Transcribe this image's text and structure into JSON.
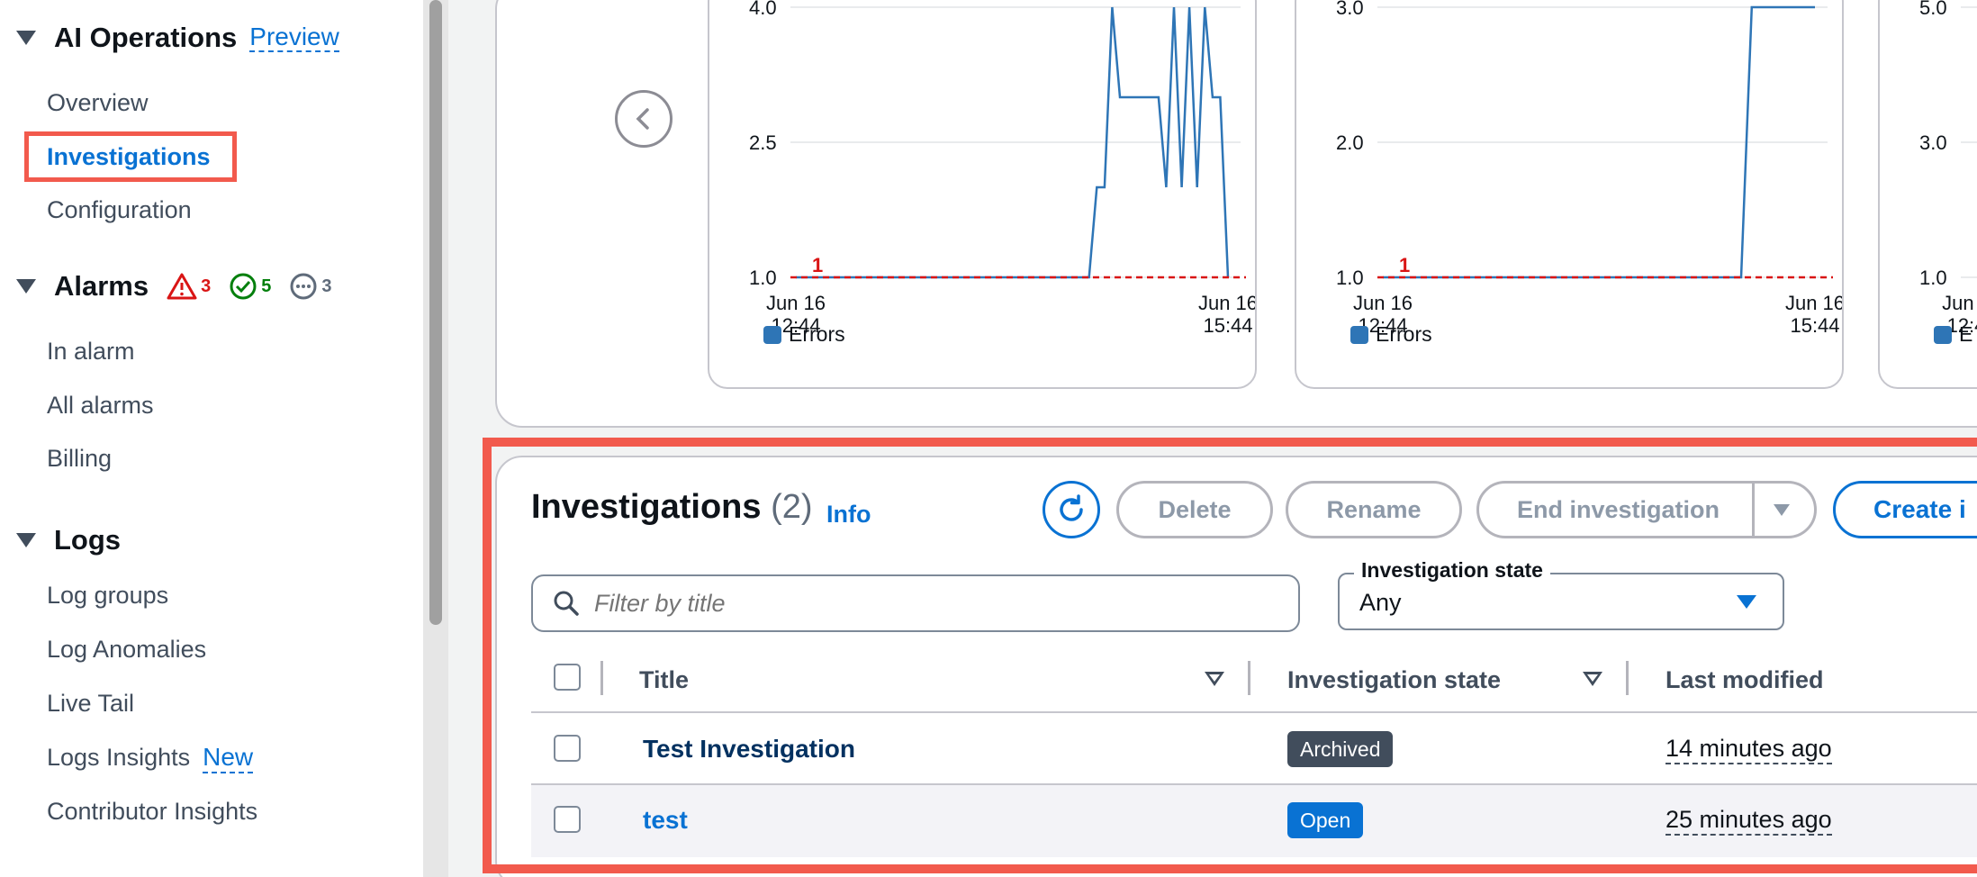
{
  "sidebar": {
    "ai_operations": {
      "title": "AI Operations",
      "preview_label": "Preview",
      "items": [
        "Overview",
        "Investigations",
        "Configuration"
      ]
    },
    "alarms": {
      "title": "Alarms",
      "in_alarm_count": "3",
      "ok_count": "5",
      "insufficient_count": "3",
      "items": [
        "In alarm",
        "All alarms",
        "Billing"
      ]
    },
    "logs": {
      "title": "Logs",
      "items": [
        "Log groups",
        "Log Anomalies",
        "Live Tail",
        "Logs Insights",
        "Contributor Insights"
      ],
      "new_label": "New"
    }
  },
  "chart_data": [
    {
      "type": "line",
      "yticks": [
        "4.0",
        "2.5",
        "1.0"
      ],
      "ylim": [
        1.0,
        4.0
      ],
      "xticks": [
        [
          "Jun 16",
          "12:44"
        ],
        [
          "Jun 16",
          "15:44"
        ]
      ],
      "threshold": 1,
      "threshold_label": "1",
      "series": [
        {
          "name": "Errors",
          "values": [
            1,
            1,
            1,
            1,
            1,
            1,
            1,
            1,
            1,
            1,
            1,
            1,
            1,
            1,
            1,
            1,
            1,
            1,
            1,
            1,
            1,
            1,
            1,
            1,
            1,
            1,
            1,
            1,
            1,
            1,
            1,
            1,
            1,
            1,
            1,
            1,
            1,
            1,
            1,
            2,
            2,
            4,
            3,
            3,
            3,
            3,
            3,
            3,
            2,
            4,
            2,
            4,
            2,
            4,
            3,
            3,
            1
          ]
        }
      ],
      "legend": "Errors"
    },
    {
      "type": "line",
      "yticks": [
        "3.0",
        "2.0",
        "1.0"
      ],
      "ylim": [
        1.0,
        3.0
      ],
      "xticks": [
        [
          "Jun 16",
          "12:44"
        ],
        [
          "Jun 16",
          "15:44"
        ]
      ],
      "threshold": 1,
      "threshold_label": "1",
      "series": [
        {
          "name": "Errors",
          "values": [
            1,
            1,
            1,
            1,
            1,
            1,
            1,
            1,
            1,
            1,
            1,
            1,
            1,
            1,
            1,
            1,
            1,
            1,
            1,
            1,
            1,
            1,
            1,
            1,
            1,
            1,
            1,
            1,
            1,
            1,
            1,
            1,
            1,
            1,
            1,
            3,
            3,
            3,
            3,
            3,
            3,
            3
          ]
        }
      ],
      "legend": "Errors"
    },
    {
      "type": "line",
      "yticks": [
        "5.0",
        "3.0",
        "1.0"
      ],
      "ylim": [
        1.0,
        5.0
      ],
      "xticks": [
        [
          "Jun 1",
          "12:4"
        ]
      ],
      "legend": "E"
    }
  ],
  "investigations": {
    "title": "Investigations",
    "count": "(2)",
    "info_label": "Info",
    "buttons": {
      "delete": "Delete",
      "rename": "Rename",
      "end": "End investigation",
      "create": "Create i"
    },
    "search_placeholder": "Filter by title",
    "state_filter_label": "Investigation state",
    "state_filter_value": "Any",
    "columns": [
      "Title",
      "Investigation state",
      "Last modified"
    ],
    "rows": [
      {
        "title": "Test Investigation",
        "state": "Archived",
        "modified": "14 minutes ago"
      },
      {
        "title": "test",
        "state": "Open",
        "modified": "25 minutes ago"
      }
    ]
  },
  "colors": {
    "accent": "#0972d3",
    "highlight": "#f25a4d",
    "series": "#2e75b6",
    "threshold": "#d91515",
    "archived": "#414d5c",
    "open": "#0972d3"
  }
}
